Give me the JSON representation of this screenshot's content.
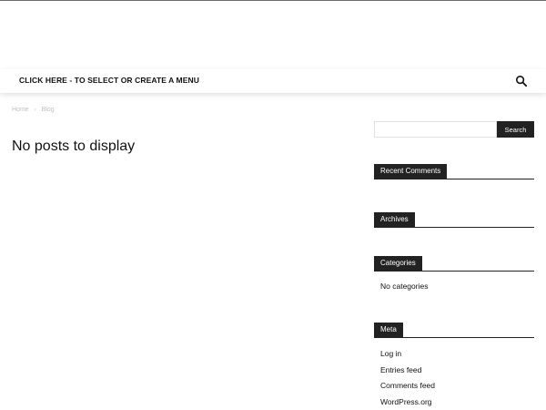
{
  "menu": {
    "label": "CLICK HERE - TO SELECT OR CREATE A MENU",
    "search_icon": "search-icon"
  },
  "breadcrumb": {
    "items": [
      "Home",
      "Blog"
    ],
    "separator": "›"
  },
  "main": {
    "title": "No posts to display"
  },
  "sidebar": {
    "search": {
      "placeholder": "",
      "value": "",
      "button_label": "Search"
    },
    "widgets": [
      {
        "title": "Recent Comments",
        "items": []
      },
      {
        "title": "Archives",
        "items": []
      },
      {
        "title": "Categories",
        "items": [
          "No categories"
        ]
      },
      {
        "title": "Meta",
        "items": [
          "Log in",
          "Entries feed",
          "Comments feed",
          "WordPress.org"
        ]
      }
    ]
  },
  "colors": {
    "widget_title_bg": "#222222",
    "widget_title_text": "#ffffff",
    "breadcrumb_text": "#c1c1c1",
    "body_text": "#111111"
  }
}
